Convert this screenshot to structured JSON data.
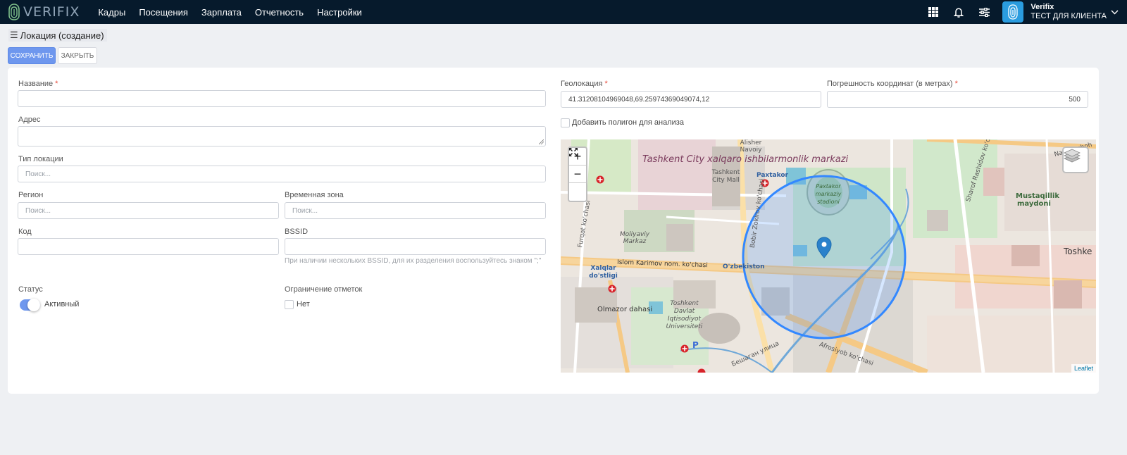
{
  "header": {
    "logo_text": "VERIFIX",
    "nav": [
      "Кадры",
      "Посещения",
      "Зарплата",
      "Отчетность",
      "Настройки"
    ],
    "icons": [
      "grid-icon",
      "bell-icon",
      "sliders-icon"
    ],
    "user_name": "Verifix",
    "user_org": "ТЕСТ ДЛЯ КЛИЕНТА"
  },
  "page": {
    "title": "Локация (создание)",
    "save_label": "СОХРАНИТЬ",
    "close_label": "ЗАКРЫТЬ"
  },
  "form": {
    "name_label": "Название",
    "name_value": "",
    "address_label": "Адрес",
    "address_value": "",
    "type_label": "Тип локации",
    "type_placeholder": "Поиск...",
    "region_label": "Регион",
    "region_placeholder": "Поиск...",
    "timezone_label": "Временная зона",
    "timezone_placeholder": "Поиск...",
    "code_label": "Код",
    "code_value": "",
    "bssid_label": "BSSID",
    "bssid_value": "",
    "bssid_hint": "При наличии нескольких BSSID, для их разделения воспользуйтесь знаком \";\"",
    "status_label": "Статус",
    "status_value": "Активный",
    "status_on": true,
    "limit_label": "Ограничение отметок",
    "limit_value": "Нет",
    "limit_checked": false,
    "geo_label": "Геолокация",
    "geo_value": "41.31208104969048,69.25974369049074,12",
    "accuracy_label": "Погрешность координат (в метрах)",
    "accuracy_value": "500",
    "polygon_label": "Добавить полигон для анализа",
    "polygon_checked": false,
    "required_mark": "*"
  },
  "map": {
    "zoom_in": "+",
    "zoom_out": "−",
    "attribution": "Leaflet",
    "labels": {
      "center": "Tashkent City xalqaro ishbilarmonlik markazi",
      "mall": "Tashkent City Mall",
      "stadium": "Paxtakor markaziy stadioni",
      "paxtakor": "Paxtakor",
      "ozbekiston": "O'zbekiston",
      "mustaqillik": "Mustaqillik maydoni",
      "toshkent": "Toshke",
      "xalqlar": "Xalqlar do'stligi",
      "olmazor": "Olmazor dahasi",
      "university": "Toshkent Davlat Iqtisodiyot Universiteti",
      "street_karimov": "Islom Karimov nom. ko'chasi",
      "navoiy_top": "Alisher Navoiy",
      "navoiy_right": "Navoiy shoh",
      "furqat": "Furqat ko'chasi",
      "afrosiyob": "Afrosiyob ko'chasi",
      "bozor": "Bobir Zokirov ko'chasi",
      "bezhogan": "Бешаган улица",
      "muloqot": "Moliyaviy Markaz",
      "sharof": "Sharof Rashidov ko'chasi"
    }
  }
}
